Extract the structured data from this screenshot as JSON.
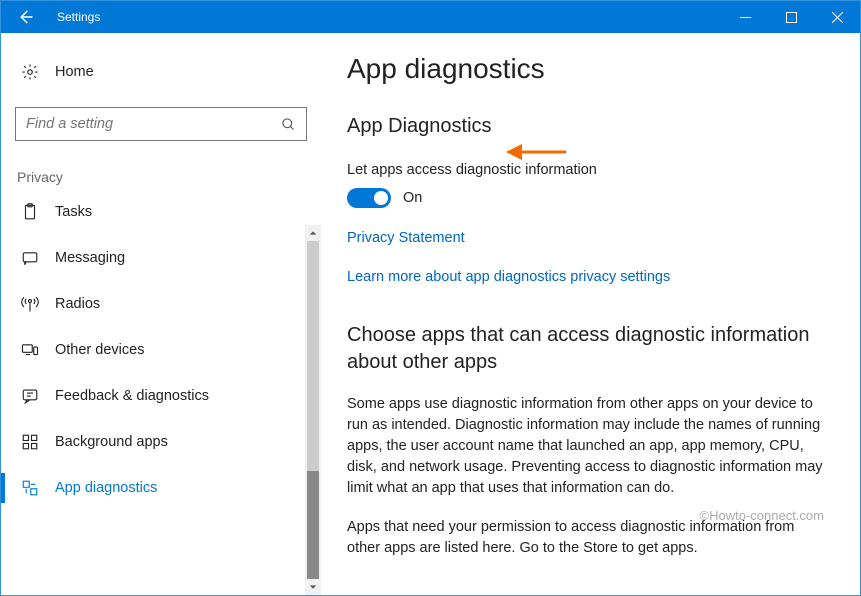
{
  "titlebar": {
    "title": "Settings"
  },
  "sidebar": {
    "home": "Home",
    "search_placeholder": "Find a setting",
    "category": "Privacy",
    "items": [
      {
        "label": "Tasks",
        "icon": "clipboard"
      },
      {
        "label": "Messaging",
        "icon": "message"
      },
      {
        "label": "Radios",
        "icon": "radio"
      },
      {
        "label": "Other devices",
        "icon": "devices"
      },
      {
        "label": "Feedback & diagnostics",
        "icon": "feedback"
      },
      {
        "label": "Background apps",
        "icon": "grid"
      },
      {
        "label": "App diagnostics",
        "icon": "diag",
        "active": true
      }
    ]
  },
  "main": {
    "page_title": "App diagnostics",
    "section_title": "App Diagnostics",
    "toggle_label": "Let apps access diagnostic information",
    "toggle_state": "On",
    "link_privacy": "Privacy Statement",
    "link_learn": "Learn more about app diagnostics privacy settings",
    "subheading": "Choose apps that can access diagnostic information about other apps",
    "para1": "Some apps use diagnostic information from other apps on your device to run as intended. Diagnostic information may include the names of running apps, the user account name that launched an app, app memory, CPU, disk, and network usage. Preventing access to diagnostic information may limit what an app that uses that information can do.",
    "para2": "Apps that need your permission to access diagnostic information from other apps are listed here. Go to the Store to get apps."
  },
  "watermark": "©Howto-connect.com"
}
